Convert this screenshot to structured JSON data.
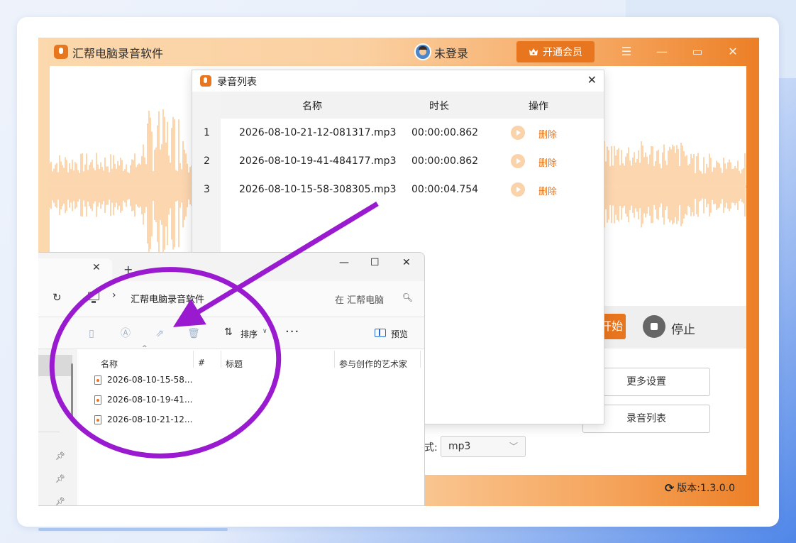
{
  "app": {
    "title": "汇帮电脑录音软件",
    "user_label": "未登录",
    "vip_button": "开通会员",
    "menu_icon": "menu-icon",
    "minimize_icon": "minimize-icon",
    "maximize_icon": "maximize-icon",
    "close_icon": "close-icon",
    "start_button": "开始",
    "stop_label": "停止",
    "more_settings_button": "更多设置",
    "recording_list_button": "录音列表",
    "format_label": "格式:",
    "format_value": "mp3",
    "version_label": "版本:1.3.0.0",
    "accent_color": "#e8761f"
  },
  "recording_dialog": {
    "title": "录音列表",
    "columns": {
      "name": "名称",
      "duration": "时长",
      "action": "操作"
    },
    "rows": [
      {
        "index": "1",
        "name": "2026-08-10-21-12-081317.mp3",
        "duration": "00:00:00.862",
        "delete": "删除"
      },
      {
        "index": "2",
        "name": "2026-08-10-19-41-484177.mp3",
        "duration": "00:00:00.862",
        "delete": "删除"
      },
      {
        "index": "3",
        "name": "2026-08-10-15-58-308305.mp3",
        "duration": "00:00:04.754",
        "delete": "删除"
      }
    ]
  },
  "explorer": {
    "path": "汇帮电脑录音软件",
    "search_placeholder": "在 汇帮电脑",
    "sort_label": "排序",
    "more_label": "···",
    "preview_label": "预览",
    "columns": {
      "name": "名称",
      "number": "#",
      "title": "标题",
      "artist": "参与创作的艺术家"
    },
    "files": [
      {
        "name": "2026-08-10-15-58..."
      },
      {
        "name": "2026-08-10-19-41..."
      },
      {
        "name": "2026-08-10-21-12..."
      }
    ]
  },
  "annotation": {
    "color": "#9a1ad0"
  }
}
